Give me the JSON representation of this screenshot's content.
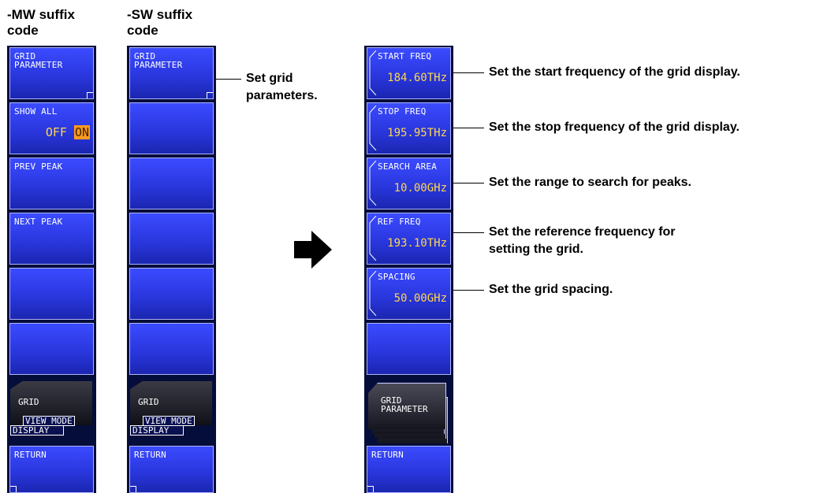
{
  "headers": {
    "mw_suffix": "-MW suffix",
    "mw_code": "code",
    "sw_suffix": "-SW suffix",
    "sw_code": "code"
  },
  "panel_mw": {
    "grid_parameter": "GRID\nPARAMETER",
    "show_all": "SHOW ALL",
    "show_all_off": "OFF",
    "show_all_on": "ON",
    "prev_peak": "PREV PEAK",
    "next_peak": "NEXT PEAK",
    "view_mode_grid": "GRID",
    "view_mode": "VIEW MODE",
    "display": "DISPLAY",
    "return": "RETURN"
  },
  "panel_sw": {
    "grid_parameter": "GRID\nPARAMETER",
    "view_mode_grid": "GRID",
    "view_mode": "VIEW MODE",
    "display": "DISPLAY",
    "return": "RETURN"
  },
  "panel_grid": {
    "start_freq": "START FREQ",
    "start_freq_value": "184.60THz",
    "stop_freq": "STOP FREQ",
    "stop_freq_value": "195.95THz",
    "search_area": "SEARCH AREA",
    "search_area_value": "10.00GHz",
    "ref_freq": "REF FREQ",
    "ref_freq_value": "193.10THz",
    "spacing": "SPACING",
    "spacing_value": "50.00GHz",
    "grid_parameter": "GRID\nPARAMETER",
    "return": "RETURN"
  },
  "annotations": {
    "set_grid_params": "Set grid\nparameters.",
    "start_freq": "Set the start frequency of the grid display.",
    "stop_freq": "Set the stop frequency of the grid display.",
    "search_area": "Set the range to search for peaks.",
    "ref_freq": "Set the reference frequency for\nsetting the grid.",
    "spacing": "Set the grid spacing."
  },
  "colors": {
    "softkey_blue": "#2a37de",
    "value_yellow": "#ffd84a",
    "on_orange": "#ff9a1e",
    "panel_dark": "#050d3a"
  },
  "icons": {
    "transition_arrow": "right-arrow-icon"
  }
}
